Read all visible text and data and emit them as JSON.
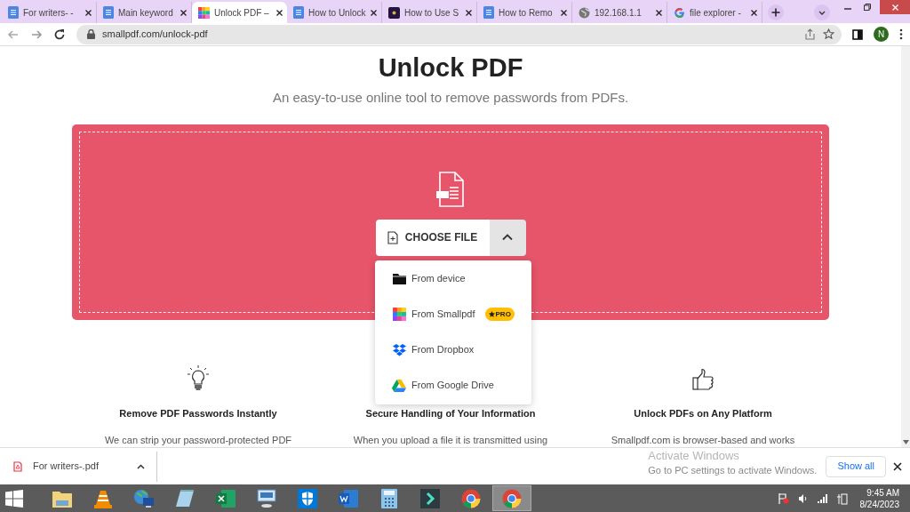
{
  "tabs": [
    {
      "title": "For writers- -",
      "kind": "docs",
      "selected": false
    },
    {
      "title": "Main keyword",
      "kind": "docs",
      "selected": false
    },
    {
      "title": "Unlock PDF –",
      "kind": "smallpdf",
      "selected": true
    },
    {
      "title": "How to Unlock",
      "kind": "docs",
      "selected": false
    },
    {
      "title": "How to Use S",
      "kind": "dark",
      "selected": false
    },
    {
      "title": "How to Remo",
      "kind": "docs",
      "selected": false
    },
    {
      "title": "192.168.1.1",
      "kind": "globe",
      "selected": false
    },
    {
      "title": "file explorer -",
      "kind": "google",
      "selected": false
    }
  ],
  "address_bar": {
    "url": "smallpdf.com/unlock-pdf",
    "profile": "N"
  },
  "page": {
    "title": "Unlock PDF",
    "subtitle": "An easy-to-use online tool to remove passwords from PDFs.",
    "choose_button": "CHOOSE FILE",
    "menu_expanded": true,
    "menu": [
      {
        "label": "From device",
        "kind": "folder"
      },
      {
        "label": "From Smallpdf",
        "kind": "smallpdf",
        "badge": "PRO"
      },
      {
        "label": "From Dropbox",
        "kind": "dropbox"
      },
      {
        "label": "From Google Drive",
        "kind": "drive"
      }
    ],
    "features": [
      {
        "kind": "bulb",
        "heading": "Remove PDF Passwords Instantly",
        "text": "We can strip your password-protected PDF"
      },
      {
        "kind": "plain",
        "heading": "Secure Handling of Your Information",
        "text": "When you upload a file it is transmitted using"
      },
      {
        "kind": "thumb",
        "heading": "Unlock PDFs on Any Platform",
        "text": "Smallpdf.com is browser-based and works"
      }
    ]
  },
  "downloads": {
    "file": "For writers-.pdf",
    "show_all": "Show all"
  },
  "activation": {
    "title": "Activate Windows",
    "text": "Go to PC settings to activate Windows."
  },
  "taskbar": {
    "apps": [
      {
        "kind": "explorer",
        "selected": false
      },
      {
        "kind": "vlc",
        "selected": false
      },
      {
        "kind": "network",
        "selected": false
      },
      {
        "kind": "notepad",
        "selected": false
      },
      {
        "kind": "excel",
        "selected": false
      },
      {
        "kind": "remote",
        "selected": false
      },
      {
        "kind": "shield",
        "selected": false
      },
      {
        "kind": "word",
        "selected": false
      },
      {
        "kind": "calculator",
        "selected": false
      },
      {
        "kind": "filmora",
        "selected": false
      },
      {
        "kind": "chrome",
        "selected": false
      },
      {
        "kind": "chrome",
        "selected": true
      }
    ],
    "time": "9:45 AM",
    "date": "8/24/2023"
  }
}
